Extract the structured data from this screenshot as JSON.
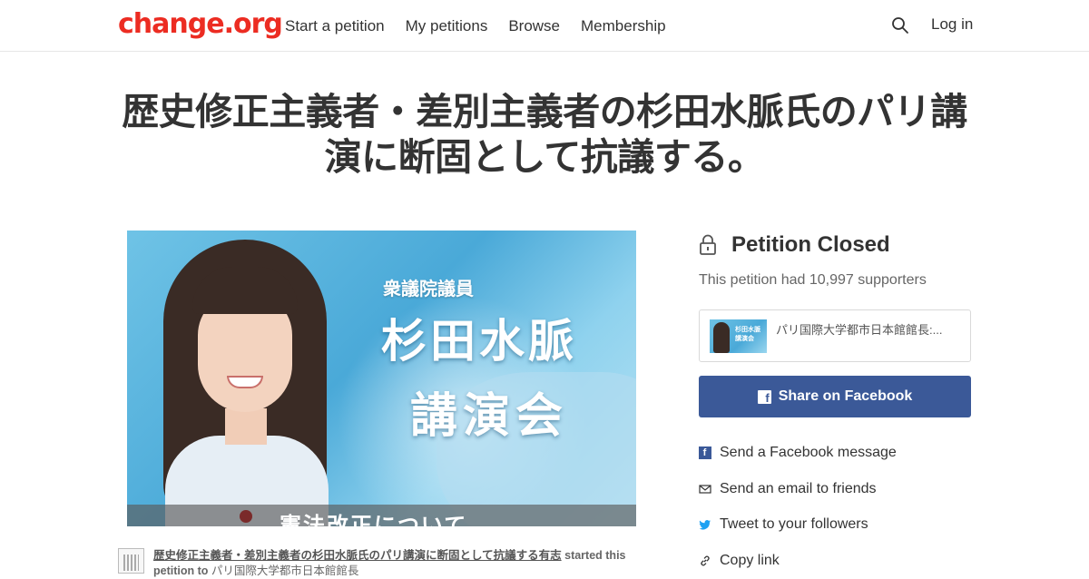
{
  "header": {
    "logo": "change.org",
    "nav": [
      "Start a petition",
      "My petitions",
      "Browse",
      "Membership"
    ],
    "login": "Log in"
  },
  "petition": {
    "title": "歴史修正主義者・差別主義者の杉田水脈氏のパリ講演に断固として抗議する。",
    "image_text": {
      "subtitle": "衆議院議員",
      "name": "杉田水脈",
      "event": "講演会",
      "banner": "憲法改正について"
    },
    "starter": {
      "name": "歴史修正主義者・差別主義者の杉田水脈氏のパリ講演に断固として抗議する有志",
      "suffix": " started this petition to",
      "recipient": "パリ国際大学都市日本館館長"
    }
  },
  "sidebar": {
    "status": "Petition Closed",
    "supporters": "This petition had 10,997 supporters",
    "card_text": "パリ国際大学都市日本館館長:...",
    "share_facebook": "Share on Facebook",
    "share_options": [
      {
        "label": "Send a Facebook message",
        "icon": "facebook-icon"
      },
      {
        "label": "Send an email to friends",
        "icon": "email-icon"
      },
      {
        "label": "Tweet to your followers",
        "icon": "twitter-icon"
      },
      {
        "label": "Copy link",
        "icon": "link-icon"
      }
    ]
  },
  "colors": {
    "brand": "#ec2c22",
    "facebook": "#3b5998",
    "twitter": "#1da1f2"
  }
}
